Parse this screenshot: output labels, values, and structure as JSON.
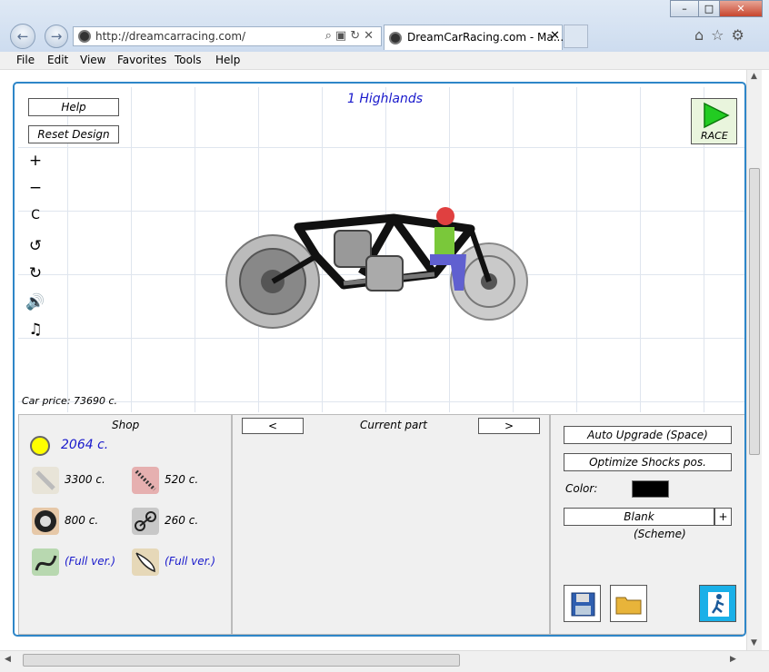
{
  "browser": {
    "url": "http://dreamcarracing.com/",
    "tab_title": "DreamCarRacing.com - Ma...",
    "menu": [
      "File",
      "Edit",
      "View",
      "Favorites",
      "Tools",
      "Help"
    ]
  },
  "game": {
    "track": "1 Highlands",
    "help_label": "Help",
    "reset_label": "Reset Design",
    "race_label": "RACE",
    "car_price": "Car price: 73690 c.",
    "shop": {
      "title": "Shop",
      "balance": "2064 c.",
      "items": [
        {
          "icon": "frame-beam-icon",
          "price": "3300 c."
        },
        {
          "icon": "shock-spring-icon",
          "price": "520 c."
        },
        {
          "icon": "wheel-icon",
          "price": "800 c."
        },
        {
          "icon": "chain-drive-icon",
          "price": "260 c."
        },
        {
          "icon": "engine-icon",
          "price": "(Full ver.)"
        },
        {
          "icon": "wing-icon",
          "price": "(Full ver.)"
        }
      ]
    },
    "current_part": {
      "prev": "<",
      "title": "Current part",
      "next": ">"
    },
    "tools": {
      "auto_upgrade": "Auto Upgrade (Space)",
      "optimize_shocks": "Optimize Shocks pos.",
      "color_label": "Color:",
      "color_value": "#000000",
      "scheme": "Blank",
      "scheme_add": "+",
      "scheme_caption": "(Scheme)"
    },
    "colors": {
      "accent": "#2e86c8",
      "balance_text": "#1a1acc",
      "race_green": "#22cc22"
    }
  }
}
